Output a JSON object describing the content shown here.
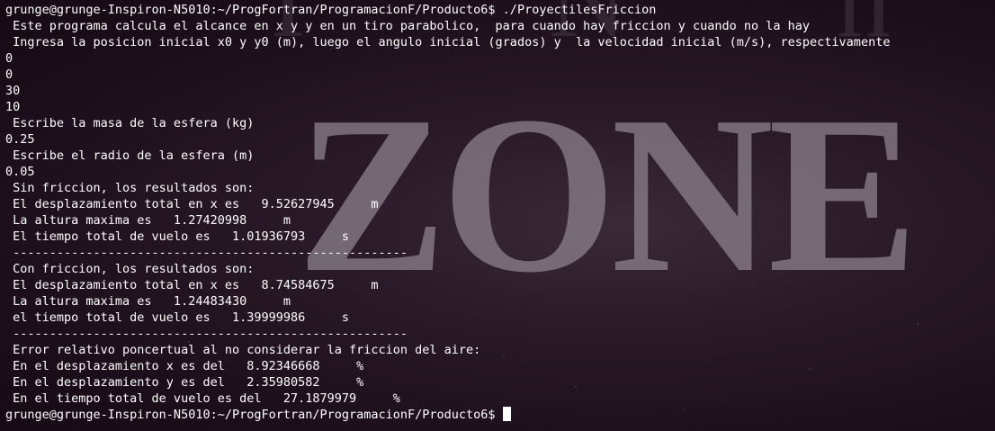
{
  "terminal": {
    "lines": [
      "grunge@grunge-Inspiron-N5010:~/ProgFortran/ProgramacionF/Producto6$ ./ProyectilesFriccion",
      " Este programa calcula el alcance en x y y en un tiro parabolico,  para cuando hay friccion y cuando no la hay",
      " Ingresa la posicion inicial x0 y y0 (m), luego el angulo inicial (grados) y  la velocidad inicial (m/s), respectivamente",
      "0",
      "0",
      "30",
      "10",
      " Escribe la masa de la esfera (kg)",
      "0.25",
      " Escribe el radio de la esfera (m)",
      "0.05",
      " Sin friccion, los resultados son:",
      " El desplazamiento total en x es   9.52627945     m",
      " La altura maxima es   1.27420998     m",
      " El tiempo total de vuelo es   1.01936793     s",
      " ------------------------------------------------------",
      " Con friccion, los resultados son:",
      " El desplazamiento total en x es   8.74584675     m",
      " La altura maxima es   1.24483430     m",
      " el tiempo total de vuelo es   1.39999986     s",
      " ------------------------------------------------------",
      " Error relativo poncertual al no considerar la friccion del aire:",
      " En el desplazamiento x es del   8.92346668     %",
      " En el desplazamiento y es del   2.35980582     %",
      " En el tiempo total de vuelo es del   27.1879979     %"
    ],
    "prompt": "grunge@grunge-Inspiron-N5010:~/ProgFortran/ProgramacionF/Producto6$ ",
    "colors": {
      "text": "#ffffff",
      "background": "#1c0f1a",
      "wallpaper_letters": "#8a7f8a"
    },
    "wallpaper_text": "ZONE"
  }
}
